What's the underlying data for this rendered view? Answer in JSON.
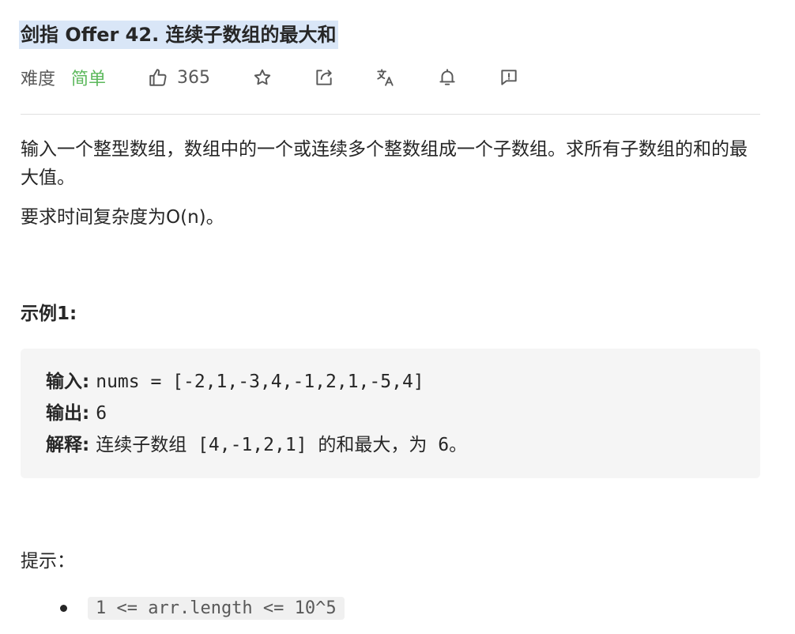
{
  "problem": {
    "title": "剑指 Offer 42. 连续子数组的最大和",
    "difficulty_label": "难度",
    "difficulty_value": "简单",
    "like_count": "365"
  },
  "toolbar_icons": [
    "thumbs-up-icon",
    "star-icon",
    "share-icon",
    "translate-icon",
    "bell-icon",
    "feedback-icon"
  ],
  "description": {
    "paragraph1": "输入一个整型数组，数组中的一个或连续多个整数组成一个子数组。求所有子数组的和的最大值。",
    "paragraph2": "要求时间复杂度为O(n)。"
  },
  "example": {
    "title": "示例1:",
    "input_label": "输入: ",
    "input_value": "nums = [-2,1,-3,4,-1,2,1,-5,4]",
    "output_label": "输出: ",
    "output_value": "6",
    "explain_label": "解释: ",
    "explain_value": "连续子数组 [4,-1,2,1] 的和最大，为 6。"
  },
  "hints": {
    "title": "提示：",
    "items": [
      "1 <= arr.length <= 10^5"
    ]
  },
  "colors": {
    "easy": "#5cb85c",
    "title_highlight": "#d9e6f7",
    "code_bg": "#f5f5f5"
  }
}
